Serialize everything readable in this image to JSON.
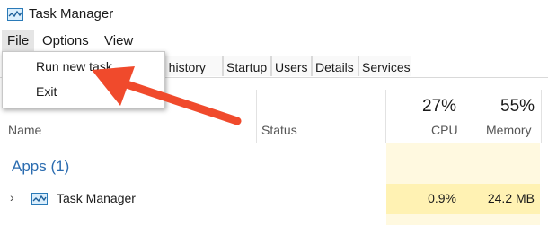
{
  "window": {
    "title": "Task Manager"
  },
  "menu": {
    "file": "File",
    "options": "Options",
    "view": "View"
  },
  "dropdown": {
    "items": [
      "Run new task",
      "Exit"
    ]
  },
  "tabs": [
    "p history",
    "Startup",
    "Users",
    "Details",
    "Services"
  ],
  "columns": {
    "name": "Name",
    "status": "Status",
    "cpu": {
      "percent": "27%",
      "label": "CPU"
    },
    "memory": {
      "percent": "55%",
      "label": "Memory"
    }
  },
  "group": {
    "title": "Apps (1)"
  },
  "rows": [
    {
      "name": "Task Manager",
      "cpu": "0.9%",
      "memory": "24.2 MB"
    }
  ],
  "colors": {
    "accent_red": "#f04a2c",
    "heatmap_light": "#fff9e0",
    "heatmap_strong": "#fff2b3",
    "group_blue": "#2b6cb0"
  },
  "icons": [
    "task-manager-icon",
    "chevron-right-icon"
  ]
}
